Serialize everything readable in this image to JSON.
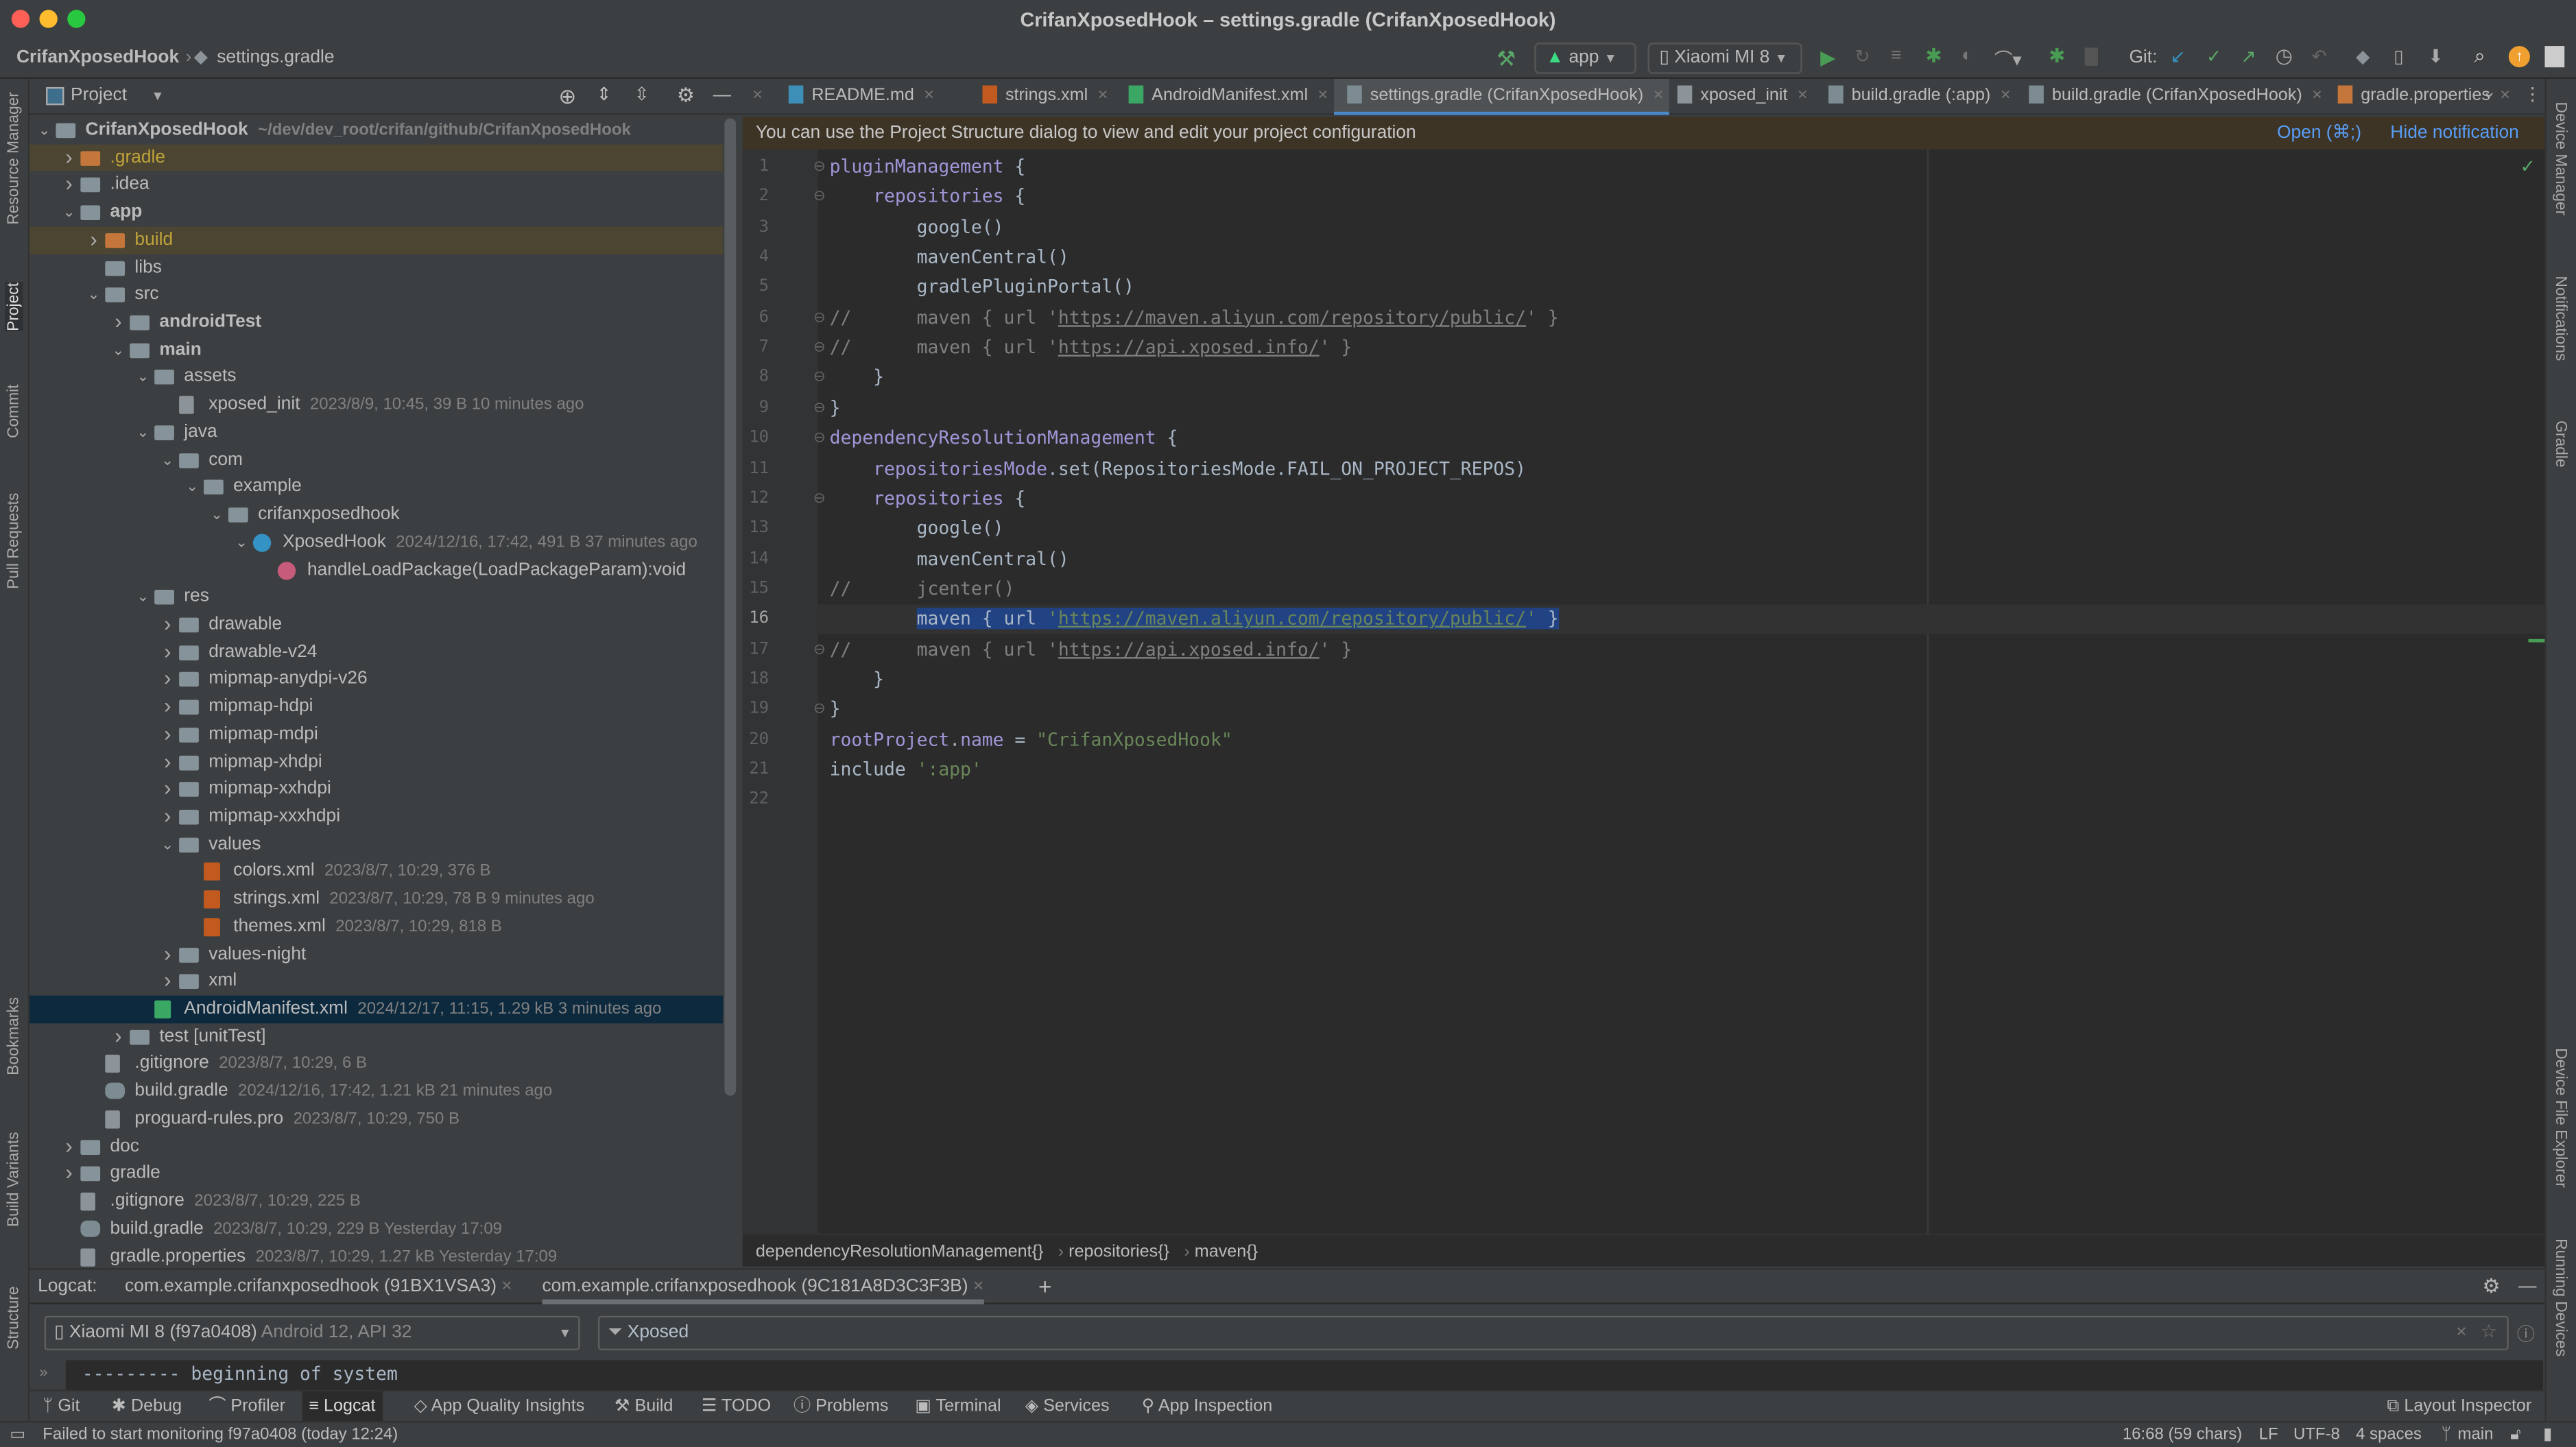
{
  "window": {
    "title": "CrifanXposedHook – settings.gradle (CrifanXposedHook)"
  },
  "navbar": {
    "project": "CrifanXposedHook",
    "file": "settings.gradle"
  },
  "toolbar": {
    "run_config": "app",
    "device": "Xiaomi MI 8",
    "git_label": "Git:"
  },
  "left_strip": [
    "Resource Manager",
    "Project",
    "Commit",
    "Pull Requests",
    "Bookmarks",
    "Build Variants",
    "Structure"
  ],
  "right_strip": [
    "Device Manager",
    "Notifications",
    "Gradle",
    "Device File Explorer",
    "Running Devices"
  ],
  "project_panel": {
    "title": "Project",
    "tree": [
      {
        "level": 0,
        "name": "CrifanXposedHook",
        "meta": "~/dev/dev_root/crifan/github/CrifanXposedHook",
        "arrow": "down",
        "icon": "module",
        "bold": true
      },
      {
        "level": 1,
        "name": ".gradle",
        "arrow": "right",
        "icon": "folder-orange",
        "style": "excluded",
        "hl": true
      },
      {
        "level": 1,
        "name": ".idea",
        "arrow": "right",
        "icon": "folder"
      },
      {
        "level": 1,
        "name": "app",
        "arrow": "down",
        "icon": "module",
        "bold": true
      },
      {
        "level": 2,
        "name": "build",
        "arrow": "right",
        "icon": "folder-orange",
        "style": "excluded",
        "hl": true
      },
      {
        "level": 2,
        "name": "libs",
        "icon": "folder"
      },
      {
        "level": 2,
        "name": "src",
        "arrow": "down",
        "icon": "folder"
      },
      {
        "level": 3,
        "name": "androidTest",
        "arrow": "right",
        "icon": "folder",
        "bold": true
      },
      {
        "level": 3,
        "name": "main",
        "arrow": "down",
        "icon": "folder",
        "bold": true
      },
      {
        "level": 4,
        "name": "assets",
        "arrow": "down",
        "icon": "folder"
      },
      {
        "level": 5,
        "name": "xposed_init",
        "meta": "2023/8/9, 10:45, 39 B 10 minutes ago",
        "icon": "file"
      },
      {
        "level": 4,
        "name": "java",
        "arrow": "down",
        "icon": "folder"
      },
      {
        "level": 5,
        "name": "com",
        "arrow": "down",
        "icon": "folder"
      },
      {
        "level": 6,
        "name": "example",
        "arrow": "down",
        "icon": "folder"
      },
      {
        "level": 7,
        "name": "crifanxposedhook",
        "arrow": "down",
        "icon": "folder"
      },
      {
        "level": 8,
        "name": "XposedHook",
        "meta": "2024/12/16, 17:42, 491 B 37 minutes ago",
        "arrow": "down",
        "icon": "class"
      },
      {
        "level": 9,
        "name": "handleLoadPackage(LoadPackageParam):void",
        "icon": "method"
      },
      {
        "level": 4,
        "name": "res",
        "arrow": "down",
        "icon": "folder"
      },
      {
        "level": 5,
        "name": "drawable",
        "arrow": "right",
        "icon": "folder"
      },
      {
        "level": 5,
        "name": "drawable-v24",
        "arrow": "right",
        "icon": "folder"
      },
      {
        "level": 5,
        "name": "mipmap-anydpi-v26",
        "arrow": "right",
        "icon": "folder"
      },
      {
        "level": 5,
        "name": "mipmap-hdpi",
        "arrow": "right",
        "icon": "folder"
      },
      {
        "level": 5,
        "name": "mipmap-mdpi",
        "arrow": "right",
        "icon": "folder"
      },
      {
        "level": 5,
        "name": "mipmap-xhdpi",
        "arrow": "right",
        "icon": "folder"
      },
      {
        "level": 5,
        "name": "mipmap-xxhdpi",
        "arrow": "right",
        "icon": "folder"
      },
      {
        "level": 5,
        "name": "mipmap-xxxhdpi",
        "arrow": "right",
        "icon": "folder"
      },
      {
        "level": 5,
        "name": "values",
        "arrow": "down",
        "icon": "folder"
      },
      {
        "level": 6,
        "name": "colors.xml",
        "meta": "2023/8/7, 10:29, 376 B",
        "icon": "xml"
      },
      {
        "level": 6,
        "name": "strings.xml",
        "meta": "2023/8/7, 10:29, 78 B 9 minutes ago",
        "icon": "xml"
      },
      {
        "level": 6,
        "name": "themes.xml",
        "meta": "2023/8/7, 10:29, 818 B",
        "icon": "xml"
      },
      {
        "level": 5,
        "name": "values-night",
        "arrow": "right",
        "icon": "folder"
      },
      {
        "level": 5,
        "name": "xml",
        "arrow": "right",
        "icon": "folder"
      },
      {
        "level": 4,
        "name": "AndroidManifest.xml",
        "meta": "2024/12/17, 11:15, 1.29 kB 3 minutes ago",
        "icon": "manifest",
        "selected": true
      },
      {
        "level": 3,
        "name": "test [unitTest]",
        "arrow": "right",
        "icon": "folder"
      },
      {
        "level": 2,
        "name": ".gitignore",
        "meta": "2023/8/7, 10:29, 6 B",
        "icon": "file"
      },
      {
        "level": 2,
        "name": "build.gradle",
        "meta": "2024/12/16, 17:42, 1.21 kB 21 minutes ago",
        "icon": "gradle"
      },
      {
        "level": 2,
        "name": "proguard-rules.pro",
        "meta": "2023/8/7, 10:29, 750 B",
        "icon": "file"
      },
      {
        "level": 1,
        "name": "doc",
        "arrow": "right",
        "icon": "folder"
      },
      {
        "level": 1,
        "name": "gradle",
        "arrow": "right",
        "icon": "folder"
      },
      {
        "level": 1,
        "name": ".gitignore",
        "meta": "2023/8/7, 10:29, 225 B",
        "icon": "file"
      },
      {
        "level": 1,
        "name": "build.gradle",
        "meta": "2023/8/7, 10:29, 229 B Yesterday 17:09",
        "icon": "gradle"
      },
      {
        "level": 1,
        "name": "gradle.properties",
        "meta": "2023/8/7, 10:29, 1.27 kB Yesterday 17:09",
        "icon": "file"
      }
    ]
  },
  "editor_tabs": [
    {
      "label": "README.md",
      "icon": "md"
    },
    {
      "label": "strings.xml",
      "icon": "xml"
    },
    {
      "label": "AndroidManifest.xml",
      "icon": "manifest"
    },
    {
      "label": "settings.gradle (CrifanXposedHook)",
      "icon": "gradle",
      "active": true
    },
    {
      "label": "xposed_init",
      "icon": "file"
    },
    {
      "label": "build.gradle (:app)",
      "icon": "gradle"
    },
    {
      "label": "build.gradle (CrifanXposedHook)",
      "icon": "gradle"
    },
    {
      "label": "gradle.properties",
      "icon": "properties"
    }
  ],
  "notification": {
    "text": "You can use the Project Structure dialog to view and edit your project configuration",
    "open": "Open (⌘;)",
    "hide": "Hide notification"
  },
  "code": {
    "current_line": 16,
    "lines": [
      [
        [
          "pluginManagement",
          "k"
        ],
        [
          " {",
          ""
        ]
      ],
      [
        [
          "    ",
          ""
        ],
        [
          "repositories",
          "k"
        ],
        [
          " {",
          ""
        ]
      ],
      [
        [
          "        google()",
          ""
        ]
      ],
      [
        [
          "        mavenCentral()",
          ""
        ]
      ],
      [
        [
          "        gradlePluginPortal()",
          ""
        ]
      ],
      [
        [
          "//      maven { url '",
          "c"
        ],
        [
          "https://maven.aliyun.com/repository/public/",
          "c u"
        ],
        [
          "' }",
          "c"
        ]
      ],
      [
        [
          "//      maven { url '",
          "c"
        ],
        [
          "https://api.xposed.info/",
          "c u"
        ],
        [
          "' }",
          "c"
        ]
      ],
      [
        [
          "    }",
          ""
        ]
      ],
      [
        [
          "}",
          ""
        ]
      ],
      [
        [
          "dependencyResolutionManagement",
          "k"
        ],
        [
          " {",
          ""
        ]
      ],
      [
        [
          "    ",
          ""
        ],
        [
          "repositoriesMode",
          "k"
        ],
        [
          ".set(RepositoriesMode.FAIL_ON_PROJECT_REPOS)",
          ""
        ]
      ],
      [
        [
          "    ",
          ""
        ],
        [
          "repositories",
          "k"
        ],
        [
          " {",
          ""
        ]
      ],
      [
        [
          "        google()",
          ""
        ]
      ],
      [
        [
          "        mavenCentral()",
          ""
        ]
      ],
      [
        [
          "//      jcenter()",
          "c"
        ]
      ],
      [
        [
          "        ",
          ""
        ],
        [
          "maven { url ",
          "sel2"
        ],
        [
          "'",
          "s sel2"
        ],
        [
          "https://maven.aliyun.com/repository/public/",
          "s u sel2"
        ],
        [
          "'",
          "s sel2"
        ],
        [
          " }",
          "sel2"
        ]
      ],
      [
        [
          "//      maven { url '",
          "c"
        ],
        [
          "https://api.xposed.info/",
          "c u"
        ],
        [
          "' }",
          "c"
        ]
      ],
      [
        [
          "    }",
          ""
        ]
      ],
      [
        [
          "}",
          ""
        ]
      ],
      [
        [
          "rootProject",
          "k"
        ],
        [
          ".",
          ""
        ],
        [
          "name",
          "k"
        ],
        [
          " = ",
          ""
        ],
        [
          "\"CrifanXposedHook\"",
          "s"
        ]
      ],
      [
        [
          "include ",
          ""
        ],
        [
          "':app'",
          "s"
        ]
      ],
      [
        [
          "",
          ""
        ]
      ]
    ]
  },
  "breadcrumbs": [
    "dependencyResolutionManagement{}",
    "repositories{}",
    "maven{}"
  ],
  "logcat": {
    "label": "Logcat:",
    "tabs": [
      {
        "label": "com.example.crifanxposedhook (91BX1VSA3)"
      },
      {
        "label": "com.example.crifanxposedhook (9C181A8D3C3F3B)",
        "active": true
      }
    ],
    "device": "Xiaomi MI 8 (f97a0408)",
    "device_detail": "Android 12, API 32",
    "filter": "Xposed",
    "output": "--------- beginning of system"
  },
  "bottom_tools": [
    {
      "label": "Git",
      "icon": "git-icon"
    },
    {
      "label": "Debug",
      "icon": "bug-icon"
    },
    {
      "label": "Profiler",
      "icon": "profiler-icon"
    },
    {
      "label": "Logcat",
      "icon": "logcat-icon",
      "active": true
    },
    {
      "label": "App Quality Insights",
      "icon": "diamond-icon"
    },
    {
      "label": "Build",
      "icon": "hammer-icon"
    },
    {
      "label": "TODO",
      "icon": "list-icon"
    },
    {
      "label": "Problems",
      "icon": "warning-icon"
    },
    {
      "label": "Terminal",
      "icon": "terminal-icon"
    },
    {
      "label": "Services",
      "icon": "services-icon"
    },
    {
      "label": "App Inspection",
      "icon": "inspect-icon"
    }
  ],
  "layout_inspector": "Layout Inspector",
  "status": {
    "message": "Failed to start monitoring f97a0408 (today 12:24)",
    "position": "16:68 (59 chars)",
    "line_sep": "LF",
    "encoding": "UTF-8",
    "indent": "4 spaces",
    "branch": "main"
  }
}
